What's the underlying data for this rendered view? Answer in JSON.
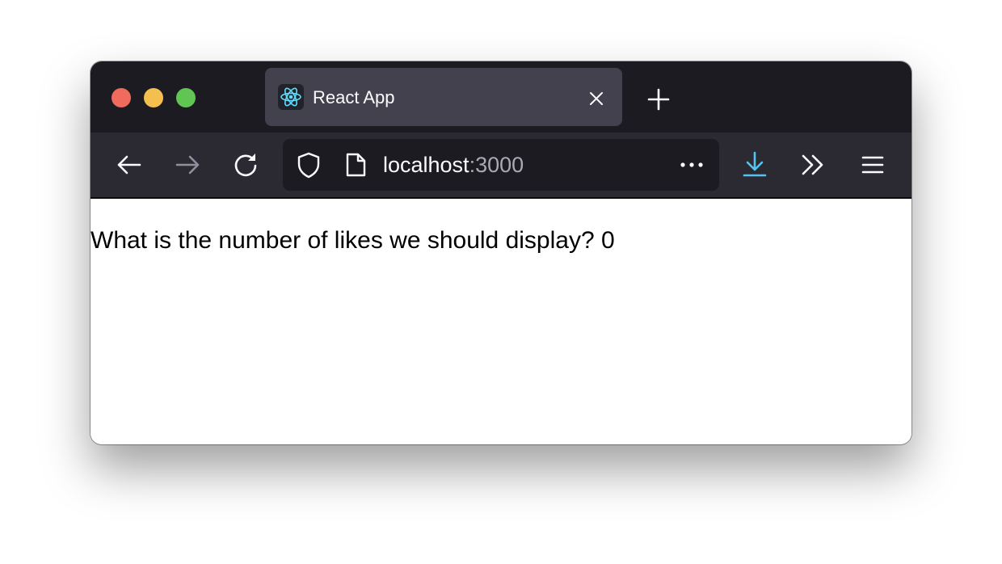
{
  "colors": {
    "titlebar_bg": "#1c1b22",
    "navbar_bg": "#2b2a33",
    "tab_bg": "#42414d",
    "traffic_close": "#ef6b5e",
    "traffic_minimize": "#f4bf4f",
    "traffic_maximize": "#61c554",
    "react_cyan": "#61dafb",
    "download_accent": "#54c4ef"
  },
  "window": {
    "tab": {
      "title": "React App",
      "favicon": "react-logo-icon"
    }
  },
  "toolbar": {
    "back": "arrow-left-icon",
    "forward": "arrow-right-icon",
    "reload": "reload-icon",
    "address": {
      "host": "localhost",
      "port": ":3000"
    },
    "icons": [
      "shield-icon",
      "page-icon",
      "more-horizontal-icon",
      "download-icon",
      "chevron-double-right-icon",
      "hamburger-menu-icon"
    ]
  },
  "page": {
    "text": "What is the number of likes we should display? 0"
  }
}
